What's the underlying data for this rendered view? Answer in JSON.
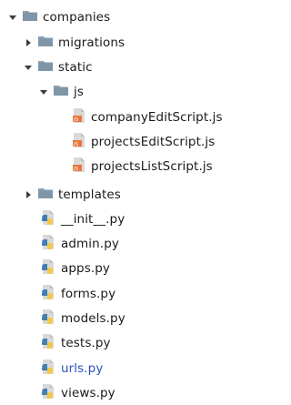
{
  "tree": {
    "root": {
      "label": "companies",
      "expanded": true,
      "icon": "folder-icon"
    },
    "migrations": {
      "label": "migrations",
      "expanded": false,
      "icon": "folder-icon"
    },
    "static": {
      "label": "static",
      "expanded": true,
      "icon": "folder-icon"
    },
    "js": {
      "label": "js",
      "expanded": true,
      "icon": "folder-icon"
    },
    "js_files": [
      {
        "label": "companyEditScript.js",
        "icon": "js-file-icon"
      },
      {
        "label": "projectsEditScript.js",
        "icon": "js-file-icon"
      },
      {
        "label": "projectsListScript.js",
        "icon": "js-file-icon"
      }
    ],
    "templates": {
      "label": "templates",
      "expanded": false,
      "icon": "folder-icon"
    },
    "py_files": [
      {
        "label": "__init__.py",
        "icon": "python-file-icon"
      },
      {
        "label": "admin.py",
        "icon": "python-file-icon"
      },
      {
        "label": "apps.py",
        "icon": "python-file-icon"
      },
      {
        "label": "forms.py",
        "icon": "python-file-icon"
      },
      {
        "label": "models.py",
        "icon": "python-file-icon"
      },
      {
        "label": "tests.py",
        "icon": "python-file-icon"
      },
      {
        "label": "urls.py",
        "icon": "python-file-icon",
        "modified_color": "#2a52be"
      },
      {
        "label": "views.py",
        "icon": "python-file-icon"
      }
    ]
  },
  "colors": {
    "folder": "#7f96a8",
    "js_badge": "#e8773b",
    "python_blue": "#3f7fb6",
    "python_yellow": "#f2c94c",
    "highlight_text": "#2a52be"
  }
}
